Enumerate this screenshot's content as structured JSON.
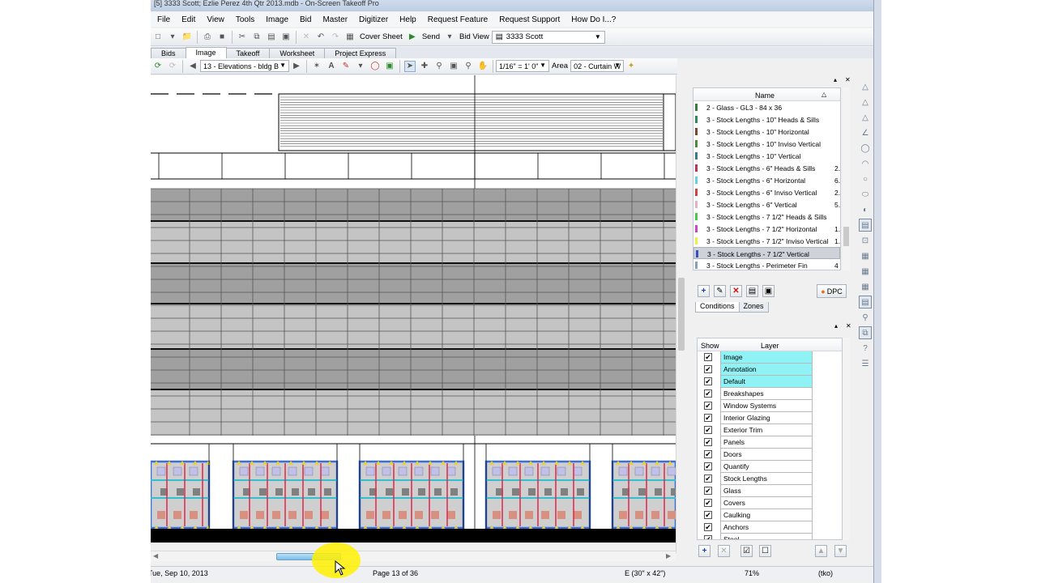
{
  "window": {
    "title": "[5] 3333 Scott; Ezlie Perez 4th Qtr 2013.mdb - On-Screen Takeoff Pro"
  },
  "menu": [
    "File",
    "Edit",
    "View",
    "Tools",
    "Image",
    "Bid",
    "Master",
    "Digitizer",
    "Help",
    "Request Feature",
    "Request Support",
    "How Do I...?"
  ],
  "toolbar": {
    "cover_sheet": "Cover Sheet",
    "send": "Send",
    "bid_view_label": "Bid View",
    "bid_view_value": "3333 Scott"
  },
  "tabs": [
    {
      "label": "Bids",
      "active": false
    },
    {
      "label": "Image",
      "active": true
    },
    {
      "label": "Takeoff",
      "active": false
    },
    {
      "label": "Worksheet",
      "active": false
    },
    {
      "label": "Project Express",
      "active": false
    }
  ],
  "imagebar": {
    "page_select": "13 - Elevations - bldg B",
    "scale_select": "1/16\" = 1' 0\"",
    "area_label": "Area",
    "area_select": "02 - Curtain W"
  },
  "conditions": {
    "column_name": "Name",
    "rows": [
      {
        "text": "2 - Glass - GL3 - 84 x 36",
        "color": "#3a7d3a",
        "val": ""
      },
      {
        "text": "3 - Stock Lengths - 10\" Heads & Sills",
        "color": "#2e8b57",
        "val": ""
      },
      {
        "text": "3 - Stock Lengths - 10\" Horizontal",
        "color": "#7a4a2e",
        "val": ""
      },
      {
        "text": "3 - Stock Lengths - 10\" Inviso Vertical",
        "color": "#4e8b3a",
        "val": ""
      },
      {
        "text": "3 - Stock Lengths - 10\" Vertical",
        "color": "#3a7a8b",
        "val": ""
      },
      {
        "text": "3 - Stock Lengths - 6\" Heads & Sills",
        "color": "#c0305a",
        "val": "2."
      },
      {
        "text": "3 - Stock Lengths - 6\" Horizontal",
        "color": "#5fd3e6",
        "val": "6."
      },
      {
        "text": "3 - Stock Lengths - 6\" Inviso Vertical",
        "color": "#d94040",
        "val": "2."
      },
      {
        "text": "3 - Stock Lengths - 6\" Vertical",
        "color": "#e8b0c8",
        "val": "5."
      },
      {
        "text": "3 - Stock Lengths - 7 1/2\" Heads & Sills",
        "color": "#44cc44",
        "val": ""
      },
      {
        "text": "3 - Stock Lengths - 7 1/2\" Horizontal",
        "color": "#cc44cc",
        "val": "1."
      },
      {
        "text": "3 - Stock Lengths - 7 1/2\" Inviso Vertical",
        "color": "#f0f040",
        "val": "1."
      },
      {
        "text": "3 - Stock Lengths - 7 1/2\" Vertical",
        "color": "#3050c0",
        "val": "",
        "selected": true
      },
      {
        "text": "3 - Stock Lengths - Perimeter Fin",
        "color": "#8ba0b8",
        "val": "4"
      }
    ],
    "dpc_label": "DPC",
    "subtabs": [
      "Conditions",
      "Zones"
    ]
  },
  "layers": {
    "column_show": "Show",
    "column_layer": "Layer",
    "rows": [
      {
        "name": "Image",
        "hl": true
      },
      {
        "name": "Annotation",
        "hl": true
      },
      {
        "name": "Default",
        "hl": true
      },
      {
        "name": "Breakshapes",
        "hl": false
      },
      {
        "name": "Window Systems",
        "hl": false
      },
      {
        "name": "Interior Glazing",
        "hl": false
      },
      {
        "name": "Exterior Trim",
        "hl": false
      },
      {
        "name": "Panels",
        "hl": false
      },
      {
        "name": "Doors",
        "hl": false
      },
      {
        "name": "Quantify",
        "hl": false
      },
      {
        "name": "Stock Lengths",
        "hl": false
      },
      {
        "name": "Glass",
        "hl": false
      },
      {
        "name": "Covers",
        "hl": false
      },
      {
        "name": "Caulking",
        "hl": false
      },
      {
        "name": "Anchors",
        "hl": false
      },
      {
        "name": "Steel",
        "hl": false
      }
    ]
  },
  "status": {
    "date": "Tue, Sep 10, 2013",
    "page": "Page 13 of 36",
    "elevation": "E (30\" x 42\")",
    "zoom": "71%",
    "user": "(tko)"
  },
  "colors": {
    "layer_highlight": "#8ff3f6",
    "drawing_gray_dark": "#a0a0a0",
    "drawing_gray_light": "#c4c4c4",
    "panel_blue": "#3b6fd8"
  }
}
